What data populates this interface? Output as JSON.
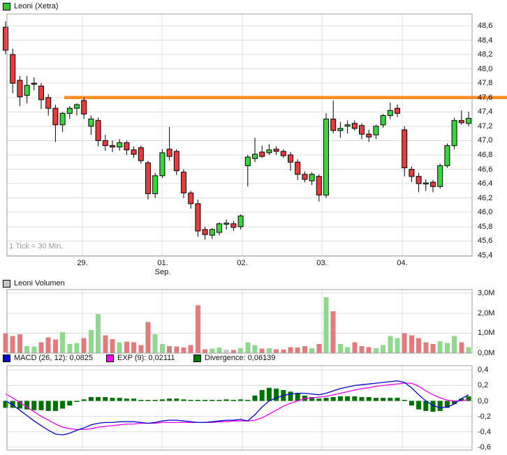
{
  "header": {
    "title": "Leoni (Xetra)",
    "marker_color": "#2FCC2F"
  },
  "volume_header": {
    "title": "Leoni Volumen",
    "marker_color": "#C8C8C8"
  },
  "macd_legend": {
    "macd_label": "MACD (26, 12): 0,0825",
    "macd_color": "#0000DD",
    "exp_label": "EXP (9): 0,02111",
    "exp_color": "#FF00FF",
    "divergence_label": "Divergence: 0,06139",
    "divergence_color": "#007700"
  },
  "price_footnote": "1 Tick = 30 Min.",
  "chart_data": [
    {
      "type": "candlestick",
      "title": "Leoni (Xetra)",
      "tick_interval_note": "1 Tick = 30 Min.",
      "x_axis": {
        "labels": [
          "29.",
          "01.",
          "02.",
          "03.",
          "04."
        ],
        "month_label": "Sep."
      },
      "y_axis": {
        "tick_labels": [
          "48,6",
          "48,4",
          "48,2",
          "48,0",
          "47,8",
          "47,6",
          "47,4",
          "47,2",
          "47,0",
          "46,8",
          "46,6",
          "46,4",
          "46,2",
          "46,0",
          "45,8",
          "45,6",
          "45,4"
        ],
        "tick_values": [
          48.6,
          48.4,
          48.2,
          48.0,
          47.8,
          47.6,
          47.4,
          47.2,
          47.0,
          46.8,
          46.6,
          46.4,
          46.2,
          46.0,
          45.8,
          45.6,
          45.4
        ],
        "min": 45.4,
        "max": 48.6
      },
      "hline": {
        "value": 47.6,
        "color": "#FF8C1E"
      },
      "colors": {
        "up": "#3CD43C",
        "down": "#E83B3B",
        "wick": "#000000",
        "grid": "#DCDCDC",
        "border": "#A0A0A0"
      },
      "ohlc": [
        [
          48.58,
          48.66,
          48.2,
          48.26
        ],
        [
          48.2,
          48.28,
          47.66,
          47.8
        ],
        [
          47.84,
          47.9,
          47.48,
          47.61
        ],
        [
          47.63,
          47.9,
          47.52,
          47.77
        ],
        [
          47.8,
          47.88,
          47.7,
          47.79
        ],
        [
          47.76,
          47.8,
          47.44,
          47.57
        ],
        [
          47.6,
          47.65,
          47.35,
          47.45
        ],
        [
          47.45,
          47.5,
          46.98,
          47.22
        ],
        [
          47.22,
          47.4,
          47.12,
          47.38
        ],
        [
          47.38,
          47.48,
          47.3,
          47.45
        ],
        [
          47.45,
          47.52,
          47.35,
          47.5
        ],
        [
          47.56,
          47.6,
          47.3,
          47.37
        ],
        [
          47.2,
          47.35,
          47.08,
          47.3
        ],
        [
          47.28,
          47.32,
          46.92,
          47.0
        ],
        [
          47.0,
          47.08,
          46.86,
          46.93
        ],
        [
          46.93,
          47.0,
          46.84,
          46.91
        ],
        [
          46.91,
          47.02,
          46.86,
          46.97
        ],
        [
          46.97,
          47.0,
          46.8,
          46.87
        ],
        [
          46.87,
          46.92,
          46.76,
          46.81
        ],
        [
          46.9,
          46.93,
          46.68,
          46.72
        ],
        [
          46.69,
          46.72,
          46.18,
          46.26
        ],
        [
          46.26,
          46.55,
          46.2,
          46.51
        ],
        [
          46.51,
          46.88,
          46.48,
          46.83
        ],
        [
          46.88,
          47.19,
          46.72,
          46.78
        ],
        [
          46.85,
          46.88,
          46.52,
          46.58
        ],
        [
          46.56,
          46.6,
          46.2,
          46.27
        ],
        [
          46.27,
          46.3,
          46.05,
          46.12
        ],
        [
          46.12,
          46.18,
          45.66,
          45.74
        ],
        [
          45.76,
          45.8,
          45.62,
          45.69
        ],
        [
          45.68,
          45.78,
          45.63,
          45.76
        ],
        [
          45.72,
          45.86,
          45.68,
          45.84
        ],
        [
          45.85,
          45.9,
          45.76,
          45.85
        ],
        [
          45.84,
          45.88,
          45.74,
          45.79
        ],
        [
          45.8,
          45.97,
          45.76,
          45.95
        ],
        [
          46.65,
          46.8,
          46.36,
          46.77
        ],
        [
          46.75,
          47.04,
          46.7,
          46.81
        ],
        [
          46.84,
          46.93,
          46.76,
          46.78
        ],
        [
          46.83,
          46.95,
          46.8,
          46.87
        ],
        [
          46.88,
          46.92,
          46.8,
          46.85
        ],
        [
          46.85,
          46.88,
          46.76,
          46.79
        ],
        [
          46.8,
          46.84,
          46.58,
          46.7
        ],
        [
          46.7,
          46.74,
          46.45,
          46.53
        ],
        [
          46.53,
          46.57,
          46.42,
          46.46
        ],
        [
          46.44,
          46.56,
          46.38,
          46.53
        ],
        [
          46.5,
          46.53,
          46.15,
          46.24
        ],
        [
          46.24,
          47.38,
          46.2,
          47.3
        ],
        [
          47.3,
          47.56,
          47.1,
          47.14
        ],
        [
          47.14,
          47.26,
          47.04,
          47.17
        ],
        [
          47.2,
          47.28,
          47.1,
          47.22
        ],
        [
          47.24,
          47.28,
          47.14,
          47.17
        ],
        [
          47.21,
          47.24,
          47.02,
          47.09
        ],
        [
          47.09,
          47.15,
          46.98,
          47.05
        ],
        [
          47.08,
          47.22,
          47.02,
          47.2
        ],
        [
          47.22,
          47.37,
          47.18,
          47.35
        ],
        [
          47.35,
          47.53,
          47.3,
          47.42
        ],
        [
          47.45,
          47.5,
          47.33,
          47.38
        ],
        [
          47.15,
          47.2,
          46.5,
          46.62
        ],
        [
          46.6,
          46.64,
          46.42,
          46.5
        ],
        [
          46.5,
          46.55,
          46.28,
          46.4
        ],
        [
          46.4,
          46.46,
          46.3,
          46.41
        ],
        [
          46.42,
          46.45,
          46.28,
          46.36
        ],
        [
          46.36,
          46.68,
          46.33,
          46.65
        ],
        [
          46.65,
          46.96,
          46.62,
          46.93
        ],
        [
          46.93,
          47.32,
          46.88,
          47.28
        ],
        [
          47.28,
          47.42,
          47.22,
          47.25
        ],
        [
          47.24,
          47.4,
          47.2,
          47.31
        ]
      ]
    },
    {
      "type": "bar",
      "title": "Leoni Volumen",
      "y_axis": {
        "tick_labels": [
          "3,0M",
          "2,0M",
          "1,0M",
          "0,0M"
        ],
        "tick_values": [
          3,
          2,
          1,
          0
        ],
        "unit": "M"
      },
      "colors": {
        "r": "#E07C7C",
        "g": "#8FD98F",
        "n": "#C8C8C8"
      },
      "bars": [
        [
          1.0,
          "r"
        ],
        [
          0.85,
          "r"
        ],
        [
          0.95,
          "r"
        ],
        [
          0.35,
          "g"
        ],
        [
          0.33,
          "g"
        ],
        [
          0.55,
          "r"
        ],
        [
          0.78,
          "r"
        ],
        [
          0.68,
          "r"
        ],
        [
          1.05,
          "g"
        ],
        [
          0.45,
          "g"
        ],
        [
          0.5,
          "g"
        ],
        [
          0.75,
          "r"
        ],
        [
          1.15,
          "g"
        ],
        [
          1.95,
          "g"
        ],
        [
          0.9,
          "r"
        ],
        [
          0.7,
          "r"
        ],
        [
          0.55,
          "g"
        ],
        [
          0.58,
          "r"
        ],
        [
          0.55,
          "r"
        ],
        [
          0.4,
          "r"
        ],
        [
          1.55,
          "r"
        ],
        [
          0.95,
          "g"
        ],
        [
          0.45,
          "g"
        ],
        [
          0.35,
          "r"
        ],
        [
          0.33,
          "r"
        ],
        [
          0.28,
          "r"
        ],
        [
          0.4,
          "r"
        ],
        [
          2.4,
          "r"
        ],
        [
          0.2,
          "r"
        ],
        [
          0.22,
          "g"
        ],
        [
          0.28,
          "g"
        ],
        [
          0.18,
          "n"
        ],
        [
          0.15,
          "r"
        ],
        [
          0.25,
          "g"
        ],
        [
          0.55,
          "g"
        ],
        [
          0.4,
          "g"
        ],
        [
          0.22,
          "r"
        ],
        [
          0.25,
          "g"
        ],
        [
          0.2,
          "r"
        ],
        [
          0.18,
          "r"
        ],
        [
          0.3,
          "r"
        ],
        [
          0.28,
          "r"
        ],
        [
          0.35,
          "r"
        ],
        [
          0.25,
          "g"
        ],
        [
          0.45,
          "r"
        ],
        [
          2.8,
          "g"
        ],
        [
          2.1,
          "r"
        ],
        [
          0.45,
          "g"
        ],
        [
          0.3,
          "g"
        ],
        [
          0.55,
          "r"
        ],
        [
          0.35,
          "r"
        ],
        [
          0.3,
          "r"
        ],
        [
          0.25,
          "g"
        ],
        [
          0.4,
          "g"
        ],
        [
          0.85,
          "g"
        ],
        [
          0.75,
          "g"
        ],
        [
          1.0,
          "r"
        ],
        [
          0.9,
          "r"
        ],
        [
          0.75,
          "r"
        ],
        [
          0.55,
          "r"
        ],
        [
          0.45,
          "r"
        ],
        [
          0.6,
          "g"
        ],
        [
          0.5,
          "g"
        ],
        [
          0.85,
          "g"
        ],
        [
          0.55,
          "r"
        ],
        [
          0.3,
          "g"
        ]
      ]
    },
    {
      "type": "line",
      "title": "MACD (26, 12) with EXP (9) signal and Divergence histogram",
      "current_values": {
        "macd": "0,0825",
        "exp": "0,02111",
        "divergence": "0,06139"
      },
      "y_axis": {
        "tick_labels": [
          "0,4",
          "0,2",
          "0,0",
          "-0,2",
          "-0,4",
          "-0,6"
        ],
        "tick_values": [
          0.4,
          0.2,
          0.0,
          -0.2,
          -0.4,
          -0.6
        ]
      },
      "colors": {
        "macd": "#0000CC",
        "signal": "#EE00EE",
        "histogram": "#007000"
      },
      "macd_series": [
        0.0,
        -0.05,
        -0.12,
        -0.19,
        -0.26,
        -0.32,
        -0.38,
        -0.43,
        -0.44,
        -0.42,
        -0.38,
        -0.35,
        -0.31,
        -0.29,
        -0.28,
        -0.28,
        -0.27,
        -0.27,
        -0.27,
        -0.28,
        -0.29,
        -0.28,
        -0.26,
        -0.25,
        -0.25,
        -0.26,
        -0.27,
        -0.28,
        -0.28,
        -0.27,
        -0.26,
        -0.25,
        -0.25,
        -0.24,
        -0.26,
        -0.18,
        -0.08,
        0.0,
        0.04,
        0.07,
        0.09,
        0.1,
        0.1,
        0.09,
        0.08,
        0.1,
        0.13,
        0.16,
        0.18,
        0.2,
        0.21,
        0.22,
        0.23,
        0.24,
        0.25,
        0.26,
        0.24,
        0.17,
        0.08,
        0.0,
        -0.06,
        -0.09,
        -0.08,
        -0.04,
        0.03,
        0.08
      ],
      "signal_series": [
        0.09,
        0.04,
        -0.02,
        -0.08,
        -0.14,
        -0.2,
        -0.25,
        -0.3,
        -0.34,
        -0.36,
        -0.37,
        -0.37,
        -0.36,
        -0.34,
        -0.33,
        -0.32,
        -0.31,
        -0.3,
        -0.3,
        -0.29,
        -0.29,
        -0.29,
        -0.28,
        -0.28,
        -0.28,
        -0.28,
        -0.28,
        -0.28,
        -0.28,
        -0.28,
        -0.27,
        -0.27,
        -0.26,
        -0.26,
        -0.26,
        -0.25,
        -0.22,
        -0.17,
        -0.12,
        -0.07,
        -0.03,
        0.0,
        0.03,
        0.04,
        0.05,
        0.06,
        0.08,
        0.1,
        0.12,
        0.14,
        0.16,
        0.17,
        0.19,
        0.2,
        0.21,
        0.22,
        0.23,
        0.23,
        0.19,
        0.13,
        0.08,
        0.04,
        0.01,
        0.0,
        0.0,
        0.02
      ]
    }
  ]
}
